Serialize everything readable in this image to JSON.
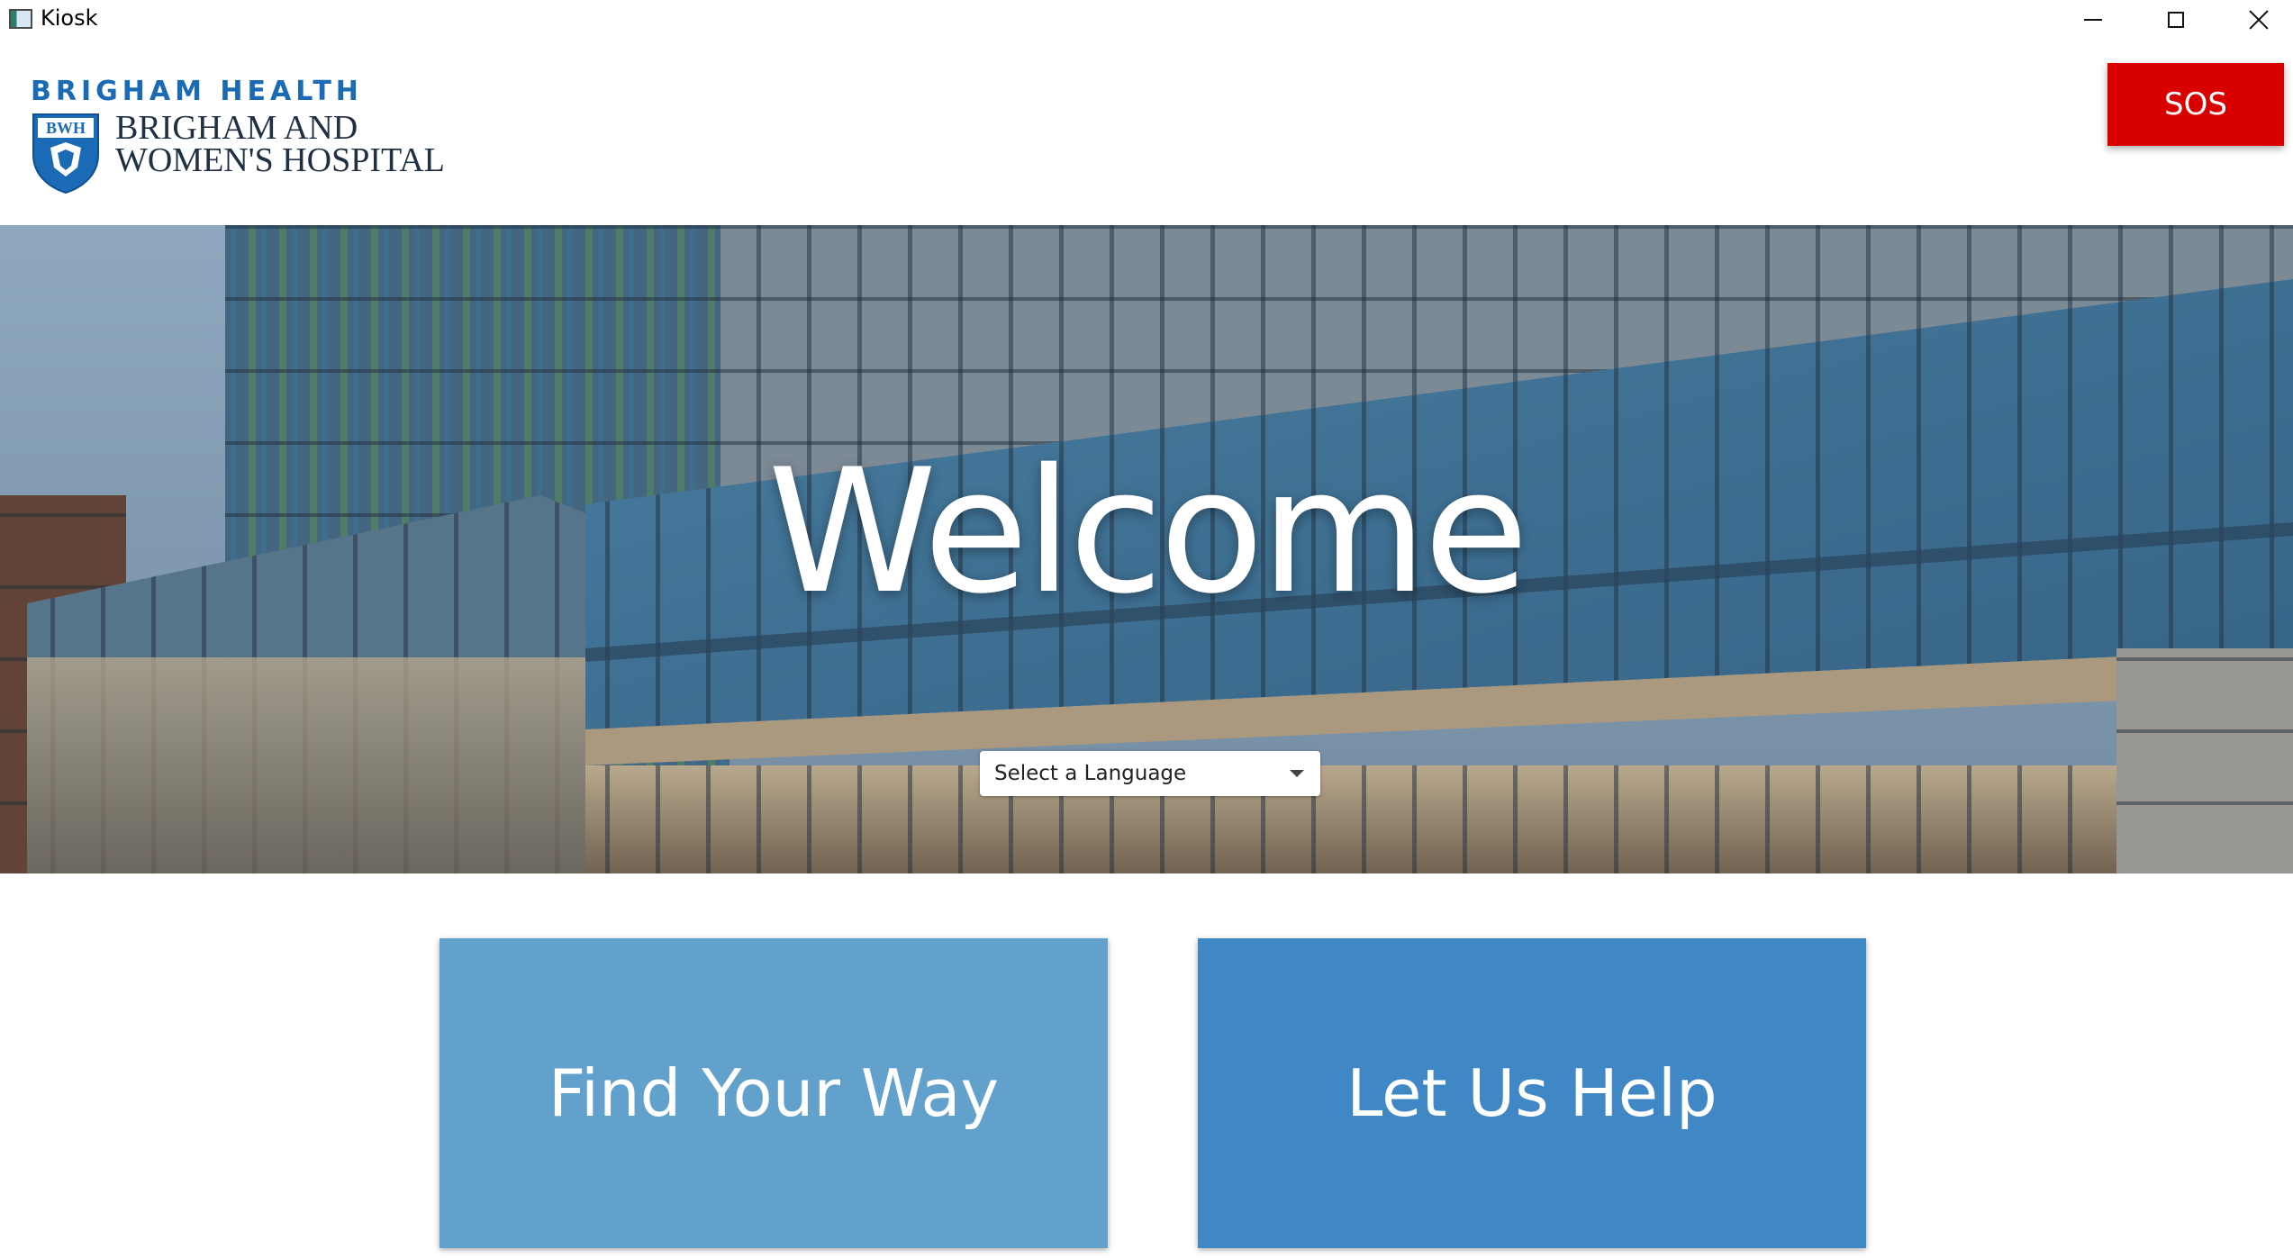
{
  "window": {
    "title": "Kiosk",
    "app_icon": "kiosk-app-icon",
    "controls": [
      "minimize-icon",
      "maximize-icon",
      "close-icon"
    ]
  },
  "header": {
    "brand": "BRIGHAM HEALTH",
    "shield_text": "BWH",
    "hospital_line1": "BRIGHAM AND",
    "hospital_line2": "WOMEN'S HOSPITAL",
    "sos_label": "SOS"
  },
  "hero": {
    "title": "Welcome",
    "language_placeholder": "Select a Language"
  },
  "actions": {
    "find_label": "Find Your Way",
    "help_label": "Let Us Help"
  },
  "colors": {
    "brand_blue": "#1b6ab5",
    "sos_red": "#d90000",
    "find_card": "#62a1cc",
    "help_card": "#3f88c5"
  }
}
